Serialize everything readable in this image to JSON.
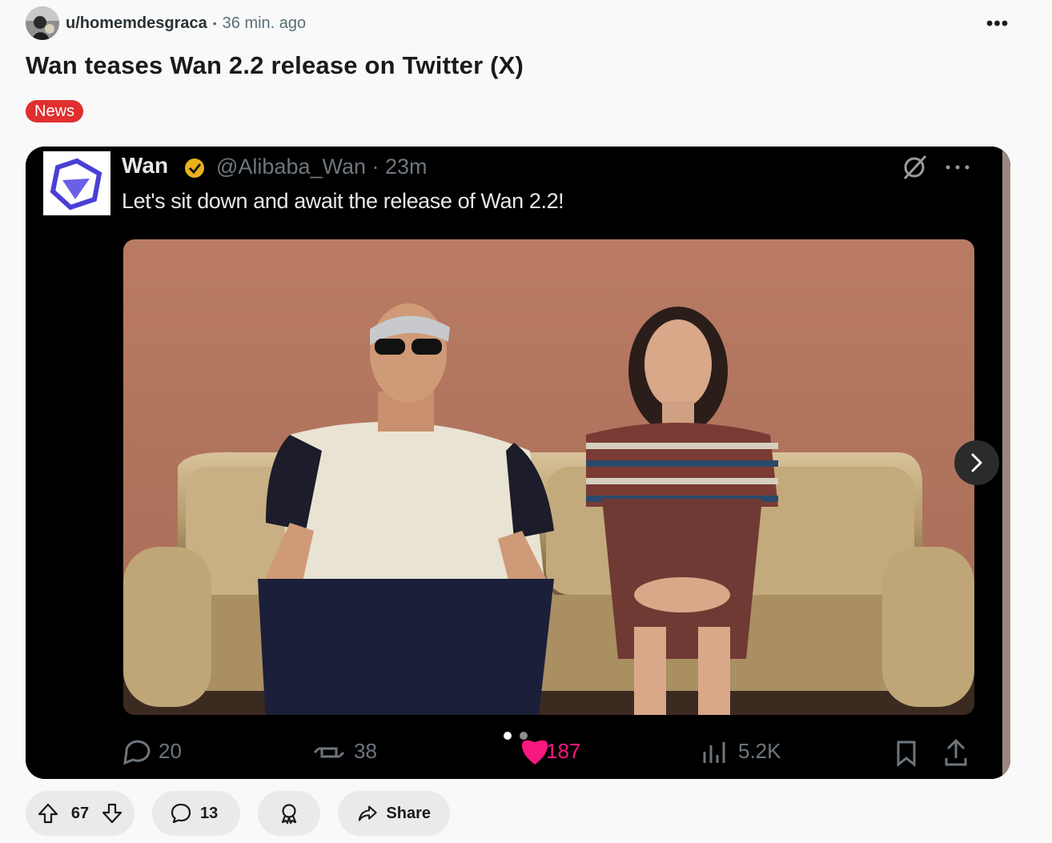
{
  "post": {
    "author": "u/homemdesgraca",
    "separator": "•",
    "time": "36 min. ago",
    "more_label": "•••",
    "title": "Wan teases Wan 2.2 release on Twitter (X)",
    "flair": "News"
  },
  "media": {
    "tweet": {
      "name": "Wan",
      "handle": "@Alibaba_Wan · 23m",
      "text": "Let's sit down and await the release of Wan 2.2!",
      "stats": {
        "replies": "20",
        "retweets": "38",
        "likes": "187",
        "views": "5.2K"
      }
    },
    "carousel": {
      "current": 1,
      "total": 2
    }
  },
  "actions": {
    "score": "67",
    "comments": "13",
    "share_label": "Share"
  },
  "colors": {
    "flair": "#e02f2f",
    "pill_bg": "#e8eaec",
    "like_pink": "#f91880",
    "wall": "#b07a63"
  }
}
